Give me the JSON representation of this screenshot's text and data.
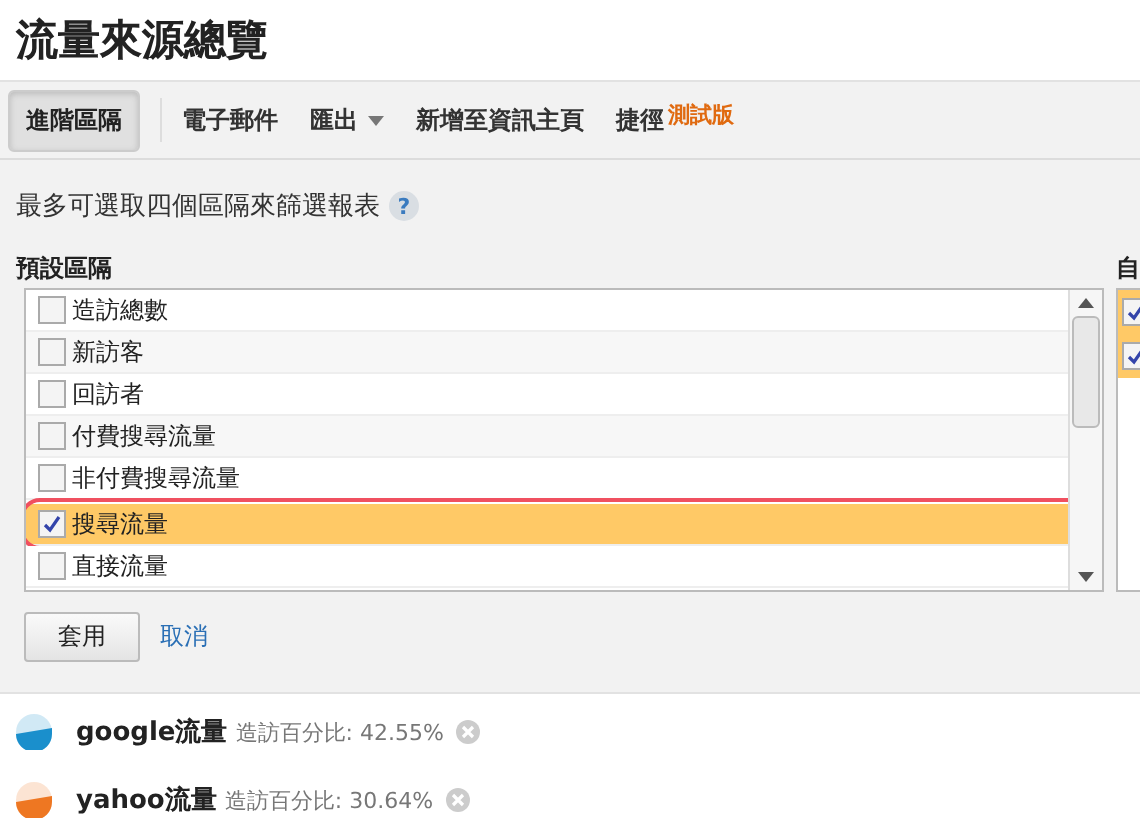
{
  "title": "流量來源總覽",
  "toolbar": [
    {
      "label": "進階區隔",
      "kind": "button",
      "selected": true
    },
    {
      "label": "電子郵件",
      "kind": "link"
    },
    {
      "label": "匯出",
      "kind": "dropdown"
    },
    {
      "label": "新增至資訊主頁",
      "kind": "link"
    },
    {
      "label": "捷徑",
      "kind": "link",
      "badge": "測試版"
    }
  ],
  "hint": "最多可選取四個區隔來篩選報表",
  "help_icon": "?",
  "default_segments": {
    "heading": "預設區隔",
    "items": [
      {
        "label": "造訪總數",
        "checked": false
      },
      {
        "label": "新訪客",
        "checked": false
      },
      {
        "label": "回訪者",
        "checked": false
      },
      {
        "label": "付費搜尋流量",
        "checked": false
      },
      {
        "label": "非付費搜尋流量",
        "checked": false
      },
      {
        "label": "搜尋流量",
        "checked": true
      },
      {
        "label": "直接流量",
        "checked": false
      }
    ]
  },
  "custom_segments": {
    "heading": "自",
    "items": [
      {
        "checked": true
      },
      {
        "checked": true
      }
    ]
  },
  "apply_button": "套用",
  "cancel_link": "取消",
  "active_segments": [
    {
      "name": "google流量",
      "metric": "造訪百分比: 42.55%",
      "color": "#1a8fcc"
    },
    {
      "name": "yahoo流量",
      "metric": "造訪百分比: 30.64%",
      "color": "#ee7722"
    }
  ]
}
